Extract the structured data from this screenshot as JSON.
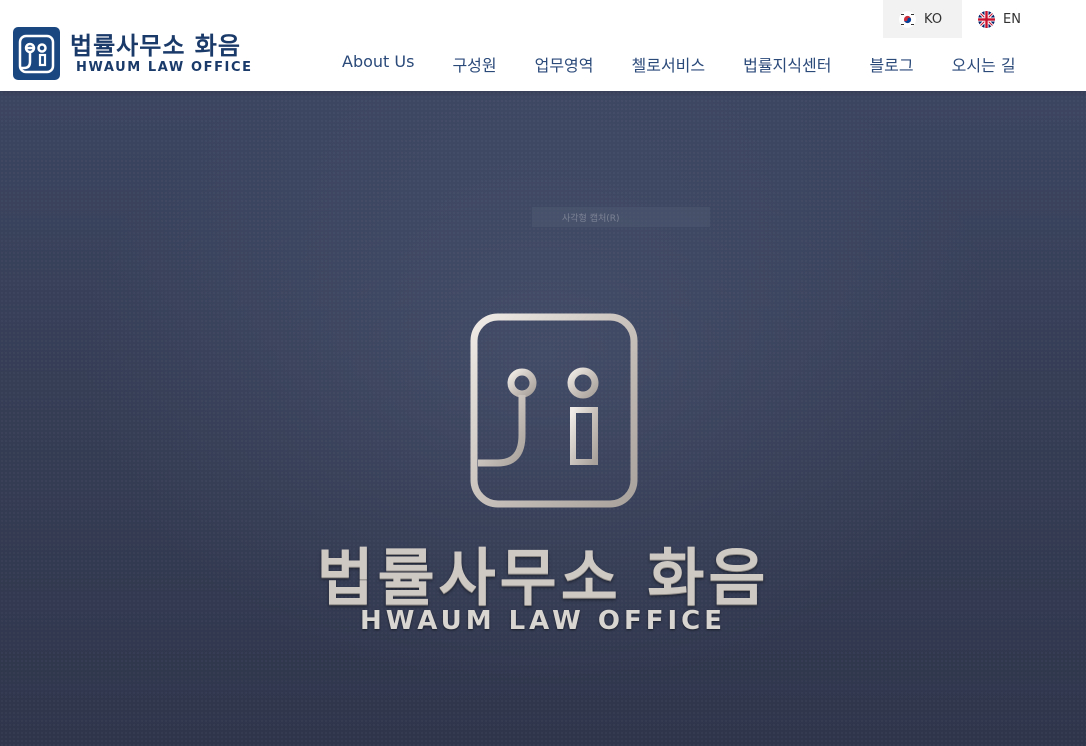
{
  "brand": {
    "name_ko": "법률사무소 화음",
    "name_en": "HWAUM LAW OFFICE",
    "primary_color": "#1a4780",
    "logo_icon": "hwaum-emblem-icon"
  },
  "languages": [
    {
      "code": "KO",
      "flag": "korea-flag-icon",
      "active": true
    },
    {
      "code": "EN",
      "flag": "uk-flag-icon",
      "active": false
    }
  ],
  "nav": [
    {
      "label": "About Us"
    },
    {
      "label": "구성원"
    },
    {
      "label": "업무영역"
    },
    {
      "label": "첼로서비스"
    },
    {
      "label": "법률지식센터"
    },
    {
      "label": "블로그"
    },
    {
      "label": "오시는 길"
    }
  ],
  "hero": {
    "title": "법률사무소 화음",
    "subtitle": "HWAUM LAW OFFICE",
    "faded_text": "사각형 캡처(R)",
    "background_color": "#363e57"
  }
}
